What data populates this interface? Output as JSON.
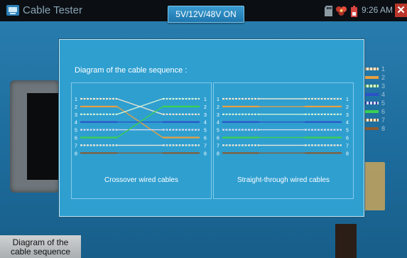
{
  "status_bar": {
    "app_title": "Cable Tester",
    "voltage_label": "5V/12V/48V ON",
    "time": "9:26 AM",
    "icons": [
      "app-icon",
      "sd-card-icon",
      "flower-icon",
      "battery-icon",
      "close-icon"
    ]
  },
  "dialog": {
    "title": "Diagram of the cable sequence :",
    "crossover": {
      "caption": "Crossover wired cables",
      "pin_labels": [
        "1",
        "2",
        "3",
        "4",
        "5",
        "6",
        "7",
        "8"
      ],
      "mapping": [
        3,
        6,
        1,
        4,
        5,
        2,
        7,
        8
      ]
    },
    "straight": {
      "caption": "Straight-through wired cables",
      "pin_labels": [
        "1",
        "2",
        "3",
        "4",
        "5",
        "6",
        "7",
        "8"
      ],
      "mapping": [
        1,
        2,
        3,
        4,
        5,
        6,
        7,
        8
      ]
    },
    "wire_colors": [
      "#f2e6d0",
      "#e8a040",
      "#d8f5d8",
      "#2a52c8",
      "#dcdcf0",
      "#3ad050",
      "#efe8d8",
      "#8a5a30"
    ],
    "wire_striped": [
      true,
      false,
      true,
      false,
      true,
      false,
      true,
      false
    ]
  },
  "background": {
    "pin_labels": [
      "1",
      "2",
      "3",
      "4",
      "5",
      "6",
      "7",
      "8"
    ]
  },
  "bottom_button": {
    "line1": "Diagram of the",
    "line2": "cable sequence"
  }
}
